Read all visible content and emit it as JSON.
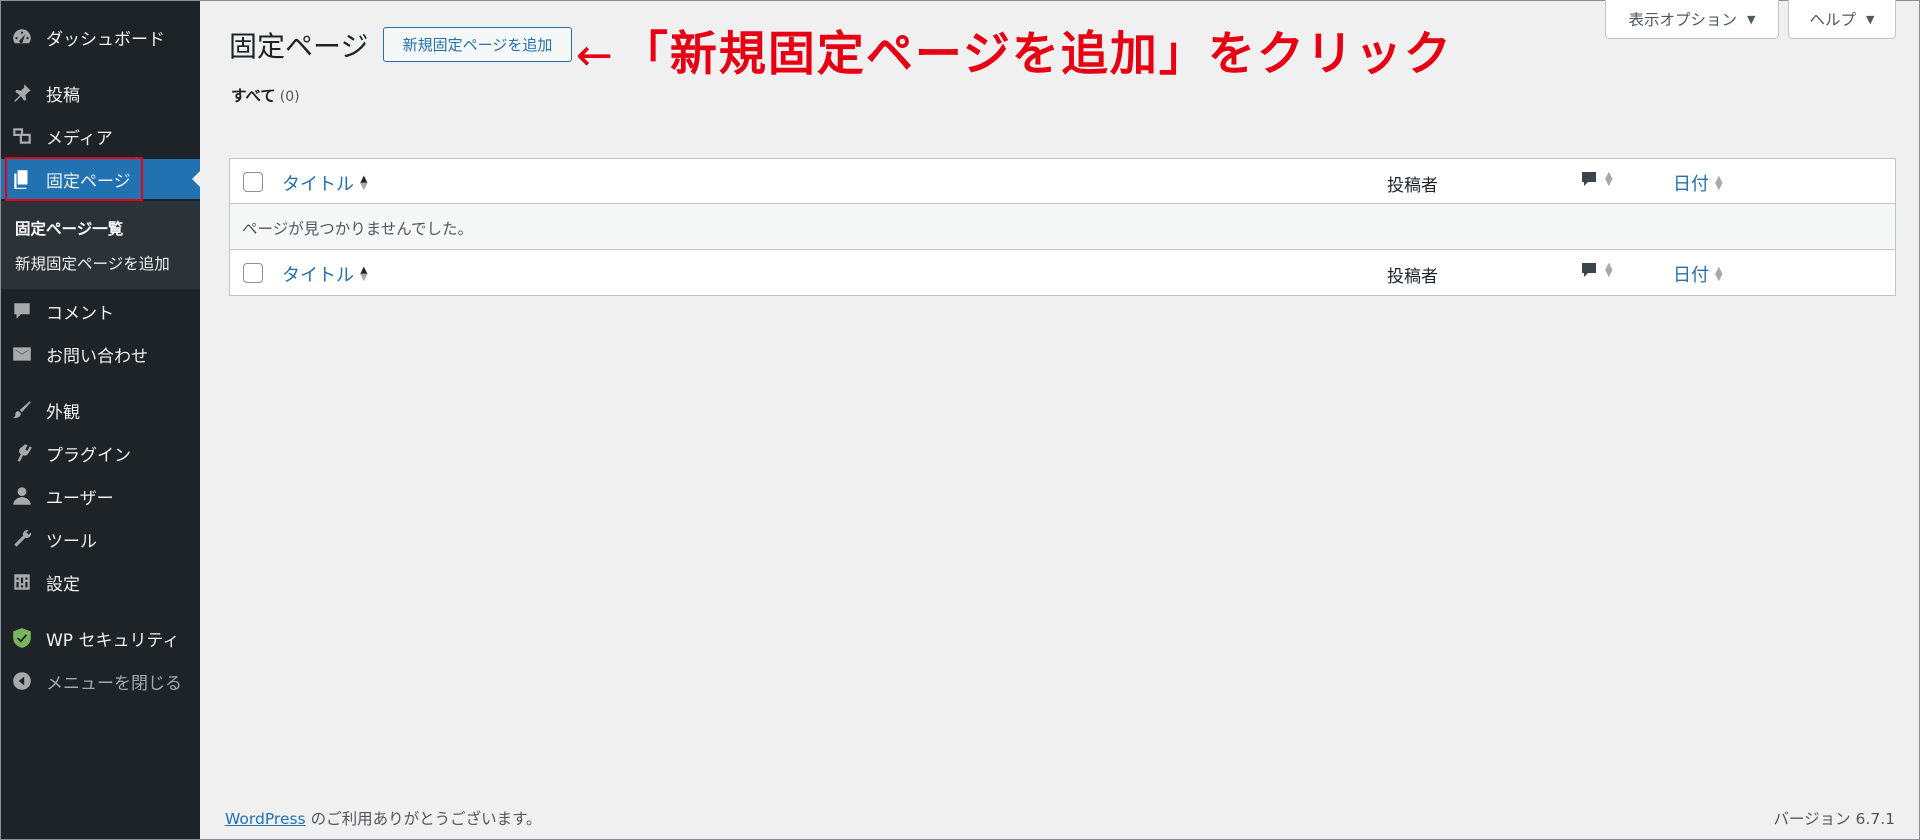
{
  "sidebar": {
    "items": [
      {
        "label": "ダッシュボード",
        "icon": "dashboard-icon"
      },
      {
        "label": "投稿",
        "icon": "pin-icon"
      },
      {
        "label": "メディア",
        "icon": "media-icon"
      },
      {
        "label": "固定ページ",
        "icon": "pages-icon"
      },
      {
        "label": "コメント",
        "icon": "comment-icon"
      },
      {
        "label": "お問い合わせ",
        "icon": "mail-icon"
      },
      {
        "label": "外観",
        "icon": "brush-icon"
      },
      {
        "label": "プラグイン",
        "icon": "plugin-icon"
      },
      {
        "label": "ユーザー",
        "icon": "user-icon"
      },
      {
        "label": "ツール",
        "icon": "wrench-icon"
      },
      {
        "label": "設定",
        "icon": "settings-icon"
      },
      {
        "label": "WP セキュリティ",
        "icon": "shield-icon"
      },
      {
        "label": "メニューを閉じる",
        "icon": "collapse-icon"
      }
    ],
    "submenu": {
      "current": "固定ページ一覧",
      "add_new": "新規固定ページを追加"
    }
  },
  "screen_tabs": {
    "options": "表示オプション",
    "help": "ヘルプ"
  },
  "header": {
    "title": "固定ページ",
    "add_new_button": "新規固定ページを追加"
  },
  "annotation": {
    "arrow": "←",
    "text": "「新規固定ページを追加」をクリック"
  },
  "filters": {
    "all_label": "すべて",
    "all_count": "(0)"
  },
  "table": {
    "columns": {
      "title": "タイトル",
      "author": "投稿者",
      "date": "日付"
    },
    "empty_message": "ページが見つかりませんでした。"
  },
  "footer": {
    "link": "WordPress",
    "thanks": " のご利用ありがとうございます。",
    "version": "バージョン 6.7.1"
  },
  "colors": {
    "accent": "#2271b1",
    "sidebar_bg": "#1d2327",
    "annotation_red": "#e60012"
  }
}
